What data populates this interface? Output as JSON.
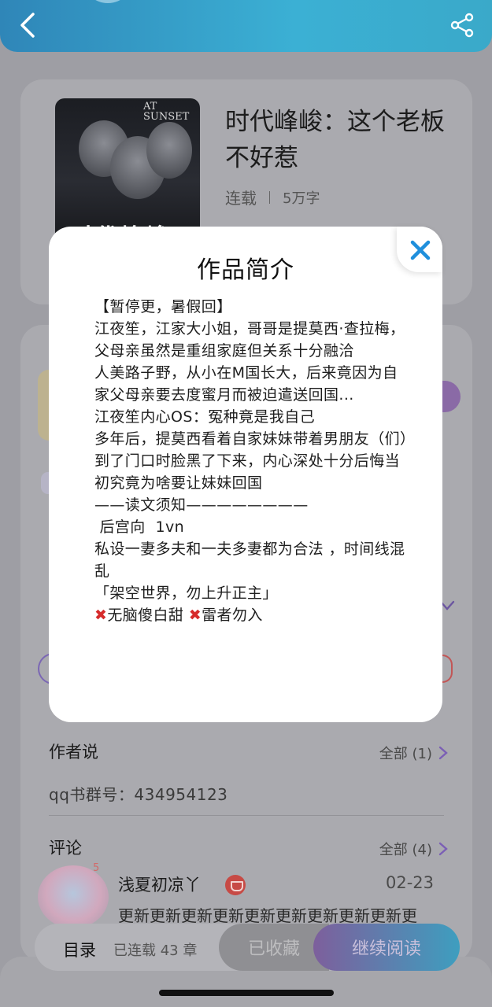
{
  "colors": {
    "accent_blue": "#2f86b8",
    "accent_purple": "#7b5fb5",
    "red_x": "#d62b2b"
  },
  "book": {
    "title": "时代峰峻：这个老板不好惹",
    "status": "连载",
    "word_count": "5万字",
    "cover_brand": "AT SUNSET",
    "cover_text": "时代峰峻"
  },
  "author_say": {
    "title": "作者说",
    "more_label": "全部 (1)",
    "text": "qq书群号：434954123"
  },
  "comments": {
    "title": "评论",
    "more_label": "全部 (4)",
    "items": [
      {
        "badge": "5",
        "name": "浅夏初凉丫",
        "date": "02-23",
        "text": "更新更新更新更新更新更新更新更新更新更"
      }
    ]
  },
  "bottom_bar": {
    "toc_label": "目录",
    "progress": "已连载 43 章",
    "collected_label": "已收藏",
    "read_label": "继续阅读"
  },
  "modal": {
    "title": "作品简介",
    "lines": [
      "【暂停更，暑假回】",
      "江夜笙，江家大小姐，哥哥是提莫西·查拉梅，父母亲虽然是重组家庭但关系十分融洽",
      "人美路子野，从小在M国长大，后来竟因为自家父母亲要去度蜜月而被迫遣送回国...",
      "江夜笙内心OS：冤种竟是我自己",
      "多年后，提莫西看着自家妹妹带着男朋友（们）到了门口时脸黑了下来，内心深处十分后悔当初究竟为啥要让妹妹回国",
      "——读文须知————————",
      " 后宫向  1vn",
      "私设一妻多夫和一夫多妻都为合法 ，时间线混乱",
      "「架空世界，勿上升正主」"
    ],
    "warning_1": "无脑傻白甜",
    "warning_2": "雷者勿入",
    "icons": {
      "close": "close-icon",
      "warning": "red-x-icon"
    }
  }
}
